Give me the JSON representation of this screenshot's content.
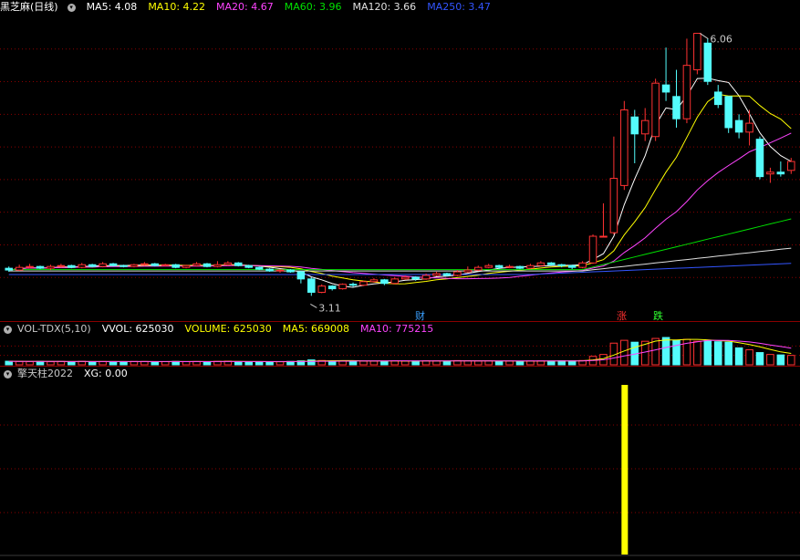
{
  "main": {
    "title": "黑芝麻(日线)",
    "ma": [
      {
        "label": "MA5: 4.08",
        "color": "#ffffff"
      },
      {
        "label": "MA10: 4.22",
        "color": "#ffff00"
      },
      {
        "label": "MA20: 4.67",
        "color": "#ff44ff"
      },
      {
        "label": "MA60: 3.96",
        "color": "#00e000"
      },
      {
        "label": "MA120: 3.66",
        "color": "#e0e0e0"
      },
      {
        "label": "MA250: 3.47",
        "color": "#3355ff"
      }
    ],
    "high_label": "6.06",
    "low_label": "3.11",
    "events": [
      {
        "text": "财",
        "color": "#3aa0ff"
      },
      {
        "text": "涨",
        "color": "#ff3030"
      },
      {
        "text": "跌",
        "color": "#30ff30"
      }
    ]
  },
  "vol": {
    "title": "VOL-TDX(5,10)",
    "fields": [
      {
        "label": "VVOL: 625030",
        "color": "#ffffff"
      },
      {
        "label": "VOLUME: 625030",
        "color": "#ffff00"
      },
      {
        "label": "MA5: 669008",
        "color": "#ffff00"
      },
      {
        "label": "MA10: 775215",
        "color": "#ff44ff"
      }
    ]
  },
  "ind": {
    "title": "擎天柱2022",
    "fields": [
      {
        "label": "XG: 0.00",
        "color": "#ffffff"
      }
    ]
  },
  "colors": {
    "up": "#ff3232",
    "down": "#54fcfc",
    "grid": "#8a0000",
    "signal": "#ffff00"
  },
  "chart_data": {
    "type": "candlestick",
    "candles": [
      [
        3.42,
        3.4,
        3.44,
        3.38
      ],
      [
        3.4,
        3.43,
        3.46,
        3.39
      ],
      [
        3.43,
        3.44,
        3.47,
        3.42
      ],
      [
        3.44,
        3.42,
        3.45,
        3.41
      ],
      [
        3.42,
        3.44,
        3.46,
        3.4
      ],
      [
        3.44,
        3.45,
        3.47,
        3.43
      ],
      [
        3.45,
        3.43,
        3.46,
        3.42
      ],
      [
        3.43,
        3.46,
        3.48,
        3.42
      ],
      [
        3.46,
        3.44,
        3.47,
        3.43
      ],
      [
        3.44,
        3.47,
        3.49,
        3.43
      ],
      [
        3.47,
        3.45,
        3.48,
        3.44
      ],
      [
        3.45,
        3.44,
        3.46,
        3.43
      ],
      [
        3.44,
        3.46,
        3.47,
        3.43
      ],
      [
        3.46,
        3.47,
        3.49,
        3.45
      ],
      [
        3.47,
        3.45,
        3.48,
        3.44
      ],
      [
        3.45,
        3.46,
        3.47,
        3.44
      ],
      [
        3.46,
        3.43,
        3.47,
        3.42
      ],
      [
        3.43,
        3.45,
        3.46,
        3.42
      ],
      [
        3.45,
        3.47,
        3.49,
        3.44
      ],
      [
        3.47,
        3.44,
        3.48,
        3.43
      ],
      [
        3.44,
        3.46,
        3.5,
        3.43
      ],
      [
        3.46,
        3.48,
        3.5,
        3.45
      ],
      [
        3.48,
        3.45,
        3.49,
        3.44
      ],
      [
        3.45,
        3.43,
        3.46,
        3.42
      ],
      [
        3.43,
        3.41,
        3.44,
        3.4
      ],
      [
        3.41,
        3.39,
        3.42,
        3.38
      ],
      [
        3.39,
        3.4,
        3.41,
        3.37
      ],
      [
        3.4,
        3.38,
        3.41,
        3.37
      ],
      [
        3.38,
        3.3,
        3.39,
        3.25
      ],
      [
        3.3,
        3.15,
        3.32,
        3.11
      ],
      [
        3.15,
        3.22,
        3.24,
        3.14
      ],
      [
        3.22,
        3.19,
        3.23,
        3.17
      ],
      [
        3.19,
        3.24,
        3.25,
        3.18
      ],
      [
        3.24,
        3.23,
        3.26,
        3.21
      ],
      [
        3.23,
        3.27,
        3.28,
        3.22
      ],
      [
        3.27,
        3.29,
        3.31,
        3.26
      ],
      [
        3.29,
        3.25,
        3.3,
        3.23
      ],
      [
        3.25,
        3.3,
        3.32,
        3.24
      ],
      [
        3.3,
        3.32,
        3.34,
        3.29
      ],
      [
        3.32,
        3.3,
        3.33,
        3.28
      ],
      [
        3.3,
        3.34,
        3.36,
        3.29
      ],
      [
        3.34,
        3.36,
        3.38,
        3.33
      ],
      [
        3.36,
        3.34,
        3.37,
        3.33
      ],
      [
        3.34,
        3.38,
        3.4,
        3.33
      ],
      [
        3.38,
        3.4,
        3.44,
        3.37
      ],
      [
        3.4,
        3.43,
        3.45,
        3.39
      ],
      [
        3.43,
        3.45,
        3.47,
        3.42
      ],
      [
        3.45,
        3.43,
        3.46,
        3.41
      ],
      [
        3.43,
        3.44,
        3.46,
        3.42
      ],
      [
        3.44,
        3.42,
        3.45,
        3.41
      ],
      [
        3.42,
        3.45,
        3.47,
        3.41
      ],
      [
        3.45,
        3.48,
        3.5,
        3.44
      ],
      [
        3.48,
        3.46,
        3.49,
        3.45
      ],
      [
        3.46,
        3.45,
        3.47,
        3.43
      ],
      [
        3.45,
        3.43,
        3.46,
        3.41
      ],
      [
        3.43,
        3.48,
        3.5,
        3.42
      ],
      [
        3.48,
        3.78,
        3.8,
        3.47
      ],
      [
        3.78,
        3.78,
        4.15,
        3.78
      ],
      [
        3.82,
        4.43,
        4.9,
        3.8
      ],
      [
        4.35,
        5.2,
        5.3,
        4.3
      ],
      [
        5.12,
        4.93,
        5.2,
        4.6
      ],
      [
        4.93,
        5.08,
        5.22,
        4.85
      ],
      [
        4.9,
        5.5,
        5.55,
        4.85
      ],
      [
        5.48,
        5.4,
        5.9,
        5.3
      ],
      [
        5.35,
        5.1,
        5.65,
        5.0
      ],
      [
        5.1,
        5.7,
        6.0,
        5.05
      ],
      [
        5.65,
        6.06,
        6.06,
        5.6
      ],
      [
        5.95,
        5.52,
        6.0,
        5.48
      ],
      [
        5.4,
        5.26,
        5.48,
        5.22
      ],
      [
        5.35,
        5.0,
        5.35,
        4.94
      ],
      [
        5.08,
        4.95,
        5.15,
        4.88
      ],
      [
        4.95,
        5.05,
        5.2,
        4.8
      ],
      [
        4.87,
        4.45,
        4.9,
        4.42
      ],
      [
        4.48,
        4.5,
        4.55,
        4.38
      ],
      [
        4.5,
        4.48,
        4.62,
        4.45
      ],
      [
        4.52,
        4.62,
        4.66,
        4.48
      ]
    ],
    "high_value": 6.06,
    "low_value": 3.11,
    "volume": [
      380,
      360,
      340,
      360,
      330,
      360,
      340,
      370,
      330,
      350,
      340,
      330,
      360,
      350,
      330,
      340,
      360,
      340,
      350,
      330,
      370,
      390,
      340,
      330,
      320,
      330,
      340,
      360,
      420,
      520,
      460,
      400,
      410,
      430,
      400,
      390,
      380,
      420,
      400,
      410,
      430,
      420,
      400,
      450,
      430,
      410,
      420,
      390,
      400,
      380,
      410,
      420,
      400,
      430,
      420,
      460,
      900,
      1100,
      2300,
      2600,
      2400,
      2500,
      2800,
      2900,
      2600,
      2700,
      2500,
      2550,
      2450,
      2400,
      1800,
      1600,
      1300,
      1100,
      1050,
      1000
    ],
    "xg_bar_index": 59
  }
}
